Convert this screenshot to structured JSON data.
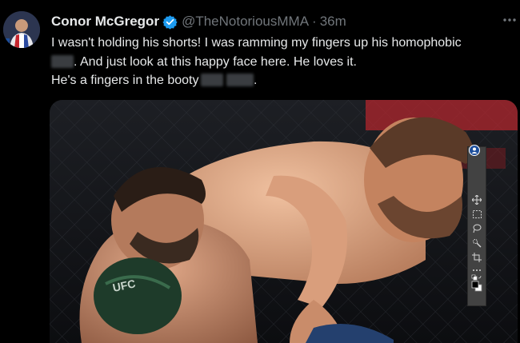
{
  "tweet": {
    "display_name": "Conor McGregor",
    "handle": "@TheNotoriousMMA",
    "separator": "·",
    "timestamp": "36m",
    "text": {
      "line1": "I wasn't holding his shorts! I was ramming my fingers up his homophobic",
      "line2": ". And just look at this happy face here. He loves it.",
      "line3": "He's a fingers in the booty",
      "line3_end": "."
    }
  },
  "icons": {
    "verified": "verified-badge-icon",
    "more": "more-options-icon",
    "toolbar": [
      "move-tool-icon",
      "marquee-tool-icon",
      "lasso-tool-icon",
      "quick-select-tool-icon",
      "crop-tool-icon",
      "more-tools-icon",
      "default-colors-icon",
      "swap-colors-icon",
      "color-swatches-icon"
    ]
  },
  "colors": {
    "background": "#000000",
    "text": "#e7e9ea",
    "muted": "#71767b",
    "verified": "#1d9bf0",
    "toolbar": "#424242",
    "octagon_red": "#c6262e"
  }
}
